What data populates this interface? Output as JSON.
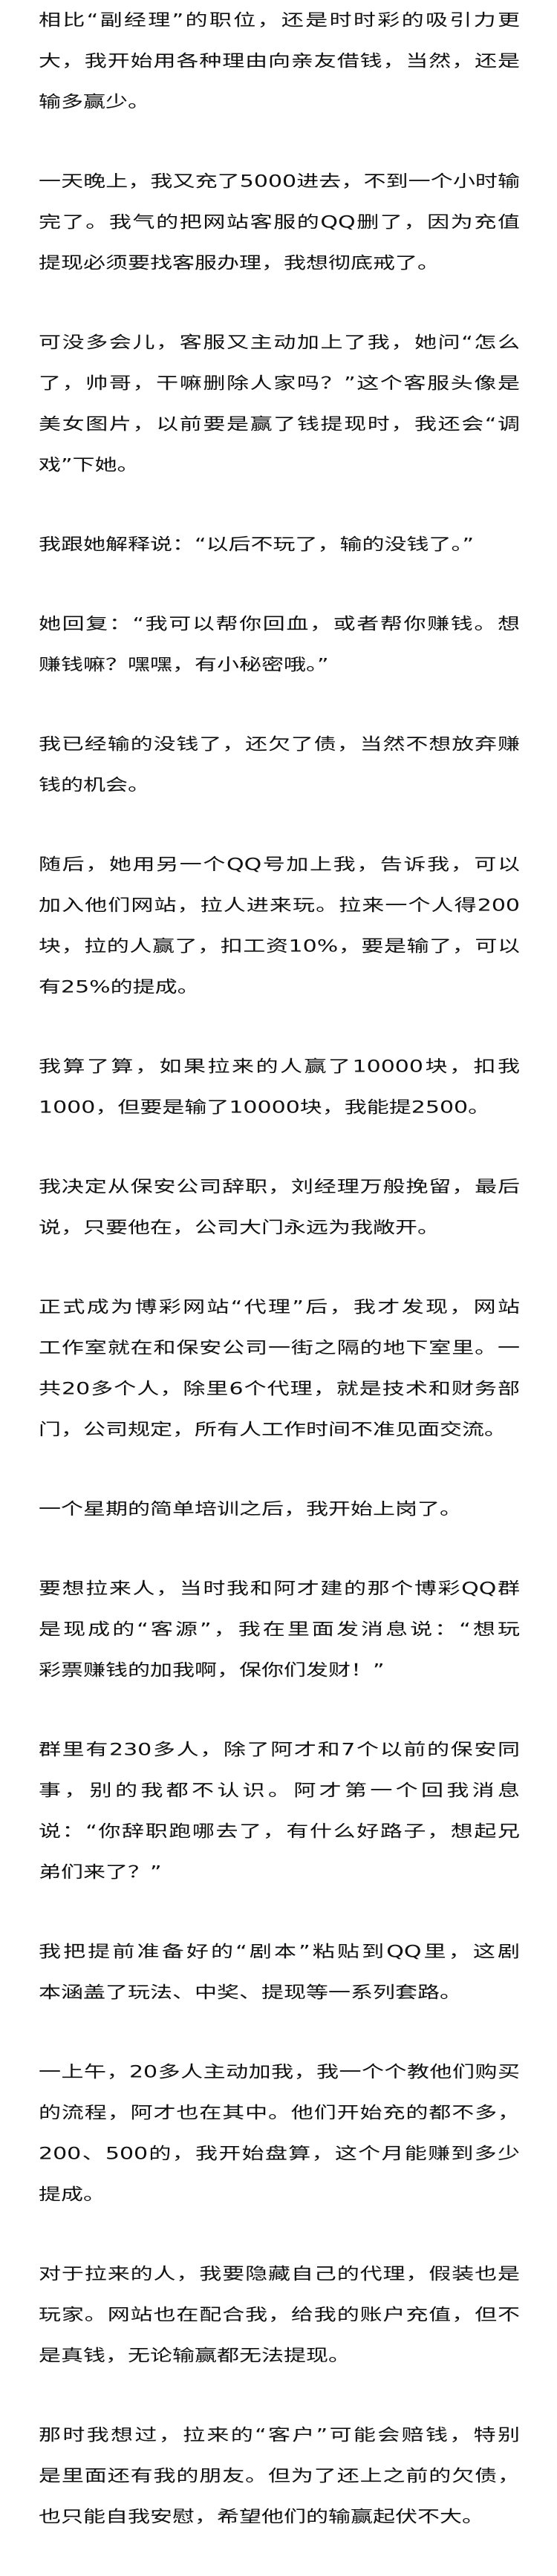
{
  "article": {
    "paragraphs": [
      {
        "lines": [
          "相比“副经理”的职位，还是时时彩的吸引力更",
          "大，我开始用各种理由向亲友借钱，当然，还是",
          "输多赢少。"
        ]
      },
      {
        "lines": [
          "一天晚上，我又充了5000进去，不到一个小时输",
          "完了。我气的把网站客服的QQ删了，因为充值",
          "提现必须要找客服办理，我想彻底戒了。"
        ]
      },
      {
        "lines": [
          "可没多会儿，客服又主动加上了我，她问“怎么",
          "了，帅哥，干嘛删除人家吗？”这个客服头像是",
          "美女图片，以前要是赢了钱提现时，我还会“调",
          "戏”下她。"
        ]
      },
      {
        "lines": [
          "我跟她解释说：“以后不玩了，输的没钱了。”"
        ]
      },
      {
        "lines": [
          "她回复：“我可以帮你回血，或者帮你赚钱。想",
          "赚钱嘛？嘿嘿，有小秘密哦。”"
        ]
      },
      {
        "lines": [
          "我已经输的没钱了，还欠了债，当然不想放弃赚",
          "钱的机会。"
        ]
      },
      {
        "lines": [
          "随后，她用另一个QQ号加上我，告诉我，可以",
          "加入他们网站，拉人进来玩。拉来一个人得200",
          "块，拉的人赢了，扣工资10%，要是输了，可以",
          "有25%的提成。"
        ]
      },
      {
        "lines": [
          "我算了算，如果拉来的人赢了10000块，扣我",
          "1000，但要是输了10000块，我能提2500。"
        ]
      },
      {
        "lines": [
          "我决定从保安公司辞职，刘经理万般挽留，最后",
          "说，只要他在，公司大门永远为我敞开。"
        ]
      },
      {
        "lines": [
          "正式成为博彩网站“代理”后，我才发现，网站",
          "工作室就在和保安公司一街之隔的地下室里。一",
          "共20多个人，除里6个代理，就是技术和财务部",
          "门，公司规定，所有人工作时间不准见面交流。"
        ]
      },
      {
        "lines": [
          "一个星期的简单培训之后，我开始上岗了。"
        ]
      },
      {
        "lines": [
          "要想拉来人，当时我和阿才建的那个博彩QQ群",
          "是现成的“客源”，我在里面发消息说：“想玩",
          "彩票赚钱的加我啊，保你们发财！”"
        ]
      },
      {
        "lines": [
          "群里有230多人，除了阿才和7个以前的保安同",
          "事，别的我都不认识。阿才第一个回我消息",
          "说：“你辞职跑哪去了，有什么好路子，想起兄",
          "弟们来了？”"
        ]
      },
      {
        "lines": [
          "我把提前准备好的“剧本”粘贴到QQ里，这剧",
          "本涵盖了玩法、中奖、提现等一系列套路。"
        ]
      },
      {
        "lines": [
          "一上午，20多人主动加我，我一个个教他们购买",
          "的流程，阿才也在其中。他们开始充的都不多，",
          "200、500的，我开始盘算，这个月能赚到多少",
          "提成。"
        ]
      },
      {
        "lines": [
          "对于拉来的人，我要隐藏自己的代理，假装也是",
          "玩家。网站也在配合我，给我的账户充值，但不",
          "是真钱，无论输赢都无法提现。"
        ]
      },
      {
        "lines": [
          "那时我想过，拉来的“客户”可能会赔钱，特别",
          "是里面还有我的朋友。但为了还上之前的欠债，",
          "也只能自我安慰，希望他们的输赢起伏不大。"
        ]
      }
    ]
  }
}
